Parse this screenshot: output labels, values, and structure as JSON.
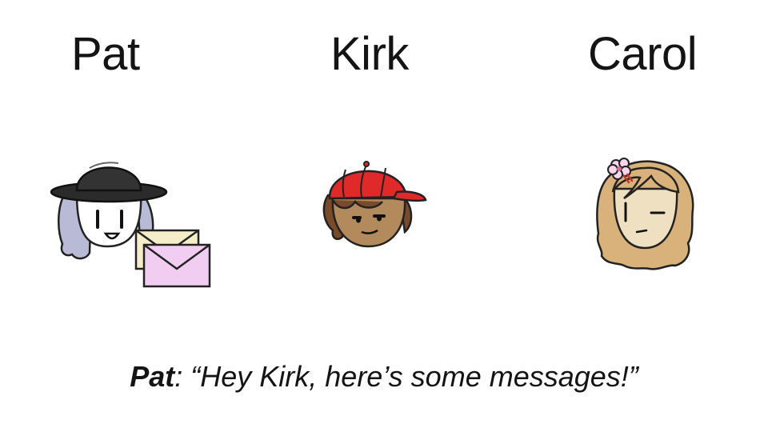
{
  "characters": [
    {
      "name": "Pat"
    },
    {
      "name": "Kirk"
    },
    {
      "name": "Carol"
    }
  ],
  "caption": {
    "speaker": "Pat",
    "separator": ": ",
    "quote": "“Hey Kirk, here’s some messages!”"
  },
  "colors": {
    "pat_hat": "#2b2b2b",
    "pat_hair": "#b9bad6",
    "kirk_cap": "#e02a2a",
    "kirk_skin": "#b38a5c",
    "kirk_hair": "#7a4b2a",
    "carol_hair": "#d8b27a",
    "carol_skin": "#efe0c2",
    "envelope_back": "#f5ecc9",
    "envelope_front": "#f2cdf2"
  },
  "icons": [
    "bowler-hat-icon",
    "envelope-icon",
    "baseball-cap-icon",
    "flower-hairpin-icon"
  ]
}
